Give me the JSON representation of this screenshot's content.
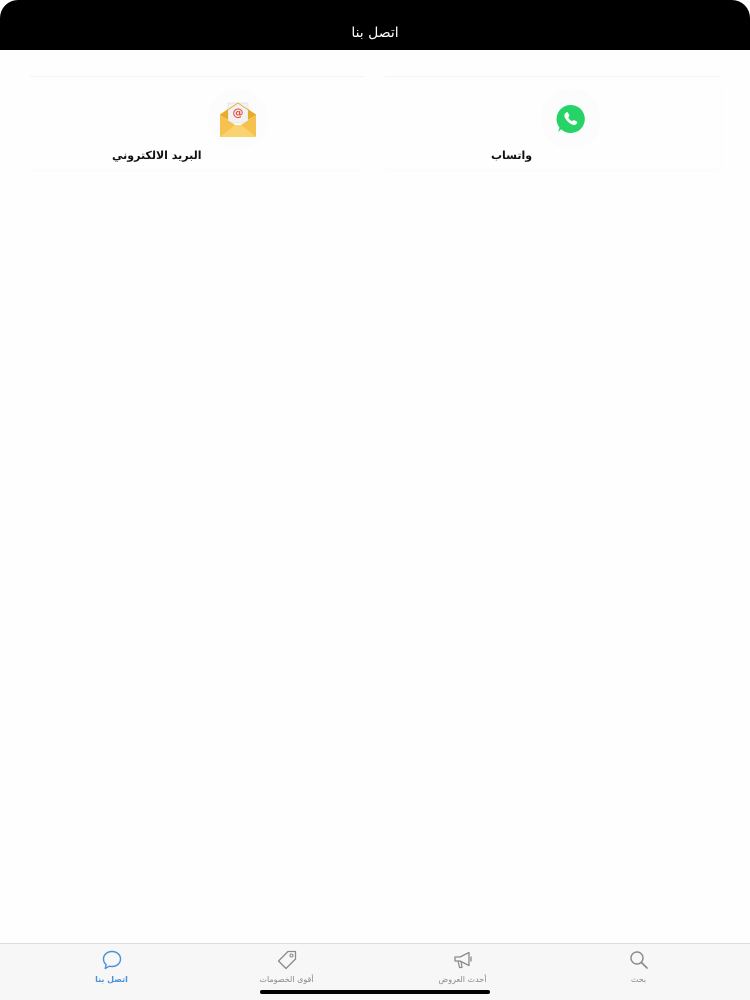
{
  "header": {
    "title": "اتصل بنا"
  },
  "contacts": {
    "whatsapp": {
      "label": "واتساب",
      "icon": "whatsapp-icon"
    },
    "email": {
      "label": "البريد الالكتروني",
      "icon": "email-envelope-icon"
    }
  },
  "tabbar": {
    "items": [
      {
        "label": "اتصل بنا",
        "icon": "chat-bubble-icon",
        "active": true
      },
      {
        "label": "أقوى الخصومات",
        "icon": "price-tag-icon",
        "active": false
      },
      {
        "label": "أحدث العروض",
        "icon": "megaphone-icon",
        "active": false
      },
      {
        "label": "بحث",
        "icon": "search-icon",
        "active": false
      }
    ]
  },
  "colors": {
    "header_bg": "#000000",
    "active_tab": "#4a90d9",
    "inactive_tab": "#8a8a8e",
    "whatsapp_green": "#25d366",
    "envelope_yellow": "#f6c24f",
    "at_symbol": "#e74c3c"
  }
}
